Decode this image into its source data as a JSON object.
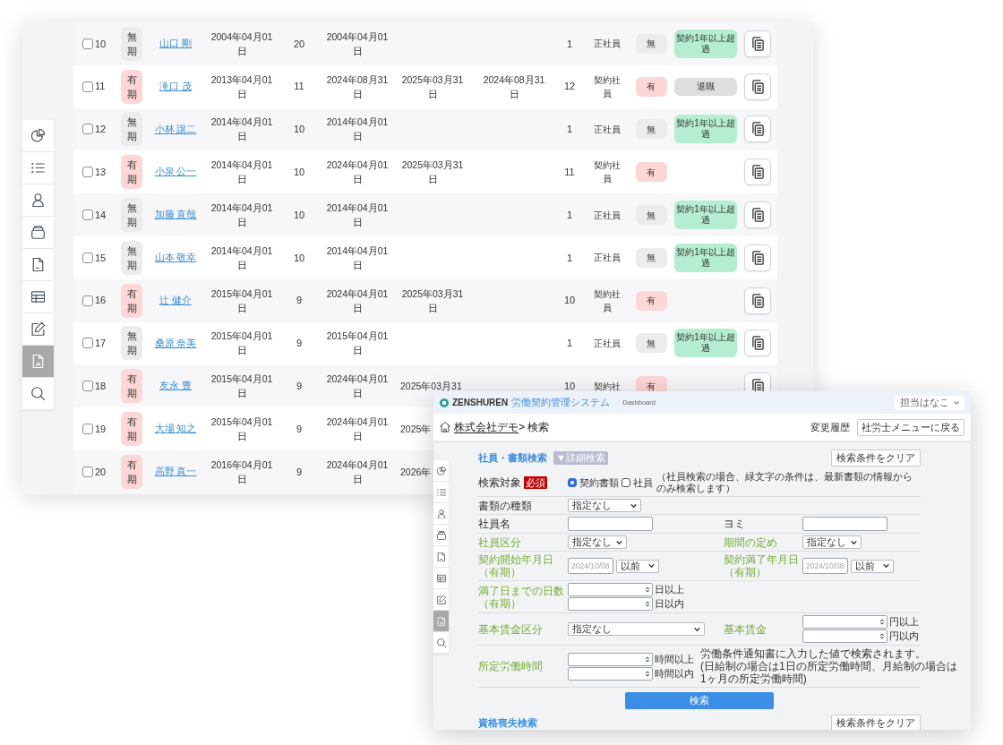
{
  "table_window": {
    "sidebar": [
      {
        "selected": false
      },
      {
        "selected": false
      },
      {
        "selected": false
      },
      {
        "selected": false
      },
      {
        "selected": false
      },
      {
        "selected": false
      },
      {
        "selected": false
      },
      {
        "selected": true
      },
      {
        "selected": false
      }
    ],
    "rows": [
      {
        "checked": false,
        "number": "10",
        "term": {
          "text": "無期",
          "color": "#ececec"
        },
        "name": "山口 剛",
        "date_1": "2004年04月01日",
        "count_1": "20",
        "date_2": "2004年04月01日",
        "count_2": "1",
        "type": "正社員",
        "flag": {
          "text": "無",
          "color": "#ececec"
        },
        "status": {
          "text": "契約1年以上超過",
          "color": "#b4edd1"
        },
        "copy_button": true
      },
      {
        "checked": false,
        "number": "11",
        "term": {
          "text": "有期",
          "color": "#fdd6d6"
        },
        "name": "滝口 茂",
        "date_1": "2013年04月01日",
        "count_1": "11",
        "date_2": "2024年08月31日",
        "date_3": "2025年03月31日",
        "date_4": "2024年08月31日",
        "count_2": "12",
        "type": "契約社員",
        "flag": {
          "text": "有",
          "color": "#fdd6d6"
        },
        "status": {
          "text": "退職",
          "color": "#dedede"
        },
        "copy_button": true
      },
      {
        "checked": false,
        "number": "12",
        "term": {
          "text": "無期",
          "color": "#ececec"
        },
        "name": "小林 譲二",
        "date_1": "2014年04月01日",
        "count_1": "10",
        "date_2": "2014年04月01日",
        "count_2": "1",
        "type": "正社員",
        "flag": {
          "text": "無",
          "color": "#ececec"
        },
        "status": {
          "text": "契約1年以上超過",
          "color": "#b4edd1"
        },
        "copy_button": true
      },
      {
        "checked": false,
        "number": "13",
        "term": {
          "text": "有期",
          "color": "#fdd6d6"
        },
        "name": "小泉 公一",
        "date_1": "2014年04月01日",
        "count_1": "10",
        "date_2": "2024年04月01日",
        "date_3": "2025年03月31日",
        "count_2": "11",
        "type": "契約社員",
        "flag": {
          "text": "有",
          "color": "#fdd6d6"
        },
        "copy_button": true
      },
      {
        "checked": false,
        "number": "14",
        "term": {
          "text": "無期",
          "color": "#ececec"
        },
        "name": "加藤 直哉",
        "date_1": "2014年04月01日",
        "count_1": "10",
        "date_2": "2014年04月01日",
        "count_2": "1",
        "type": "正社員",
        "flag": {
          "text": "無",
          "color": "#ececec"
        },
        "status": {
          "text": "契約1年以上超過",
          "color": "#b4edd1"
        },
        "copy_button": true
      },
      {
        "checked": false,
        "number": "15",
        "term": {
          "text": "無期",
          "color": "#ececec"
        },
        "name": "山本 敬幸",
        "date_1": "2014年04月01日",
        "count_1": "10",
        "date_2": "2014年04月01日",
        "count_2": "1",
        "type": "正社員",
        "flag": {
          "text": "無",
          "color": "#ececec"
        },
        "status": {
          "text": "契約1年以上超過",
          "color": "#b4edd1"
        },
        "copy_button": true
      },
      {
        "checked": false,
        "number": "16",
        "term": {
          "text": "有期",
          "color": "#fdd6d6"
        },
        "name": "辻 健介",
        "date_1": "2015年04月01日",
        "count_1": "9",
        "date_2": "2024年04月01日",
        "date_3": "2025年03月31日",
        "count_2": "10",
        "type": "契約社員",
        "flag": {
          "text": "有",
          "color": "#fdd6d6"
        },
        "copy_button": true
      },
      {
        "checked": false,
        "number": "17",
        "term": {
          "text": "無期",
          "color": "#ececec"
        },
        "name": "桑原 奈美",
        "date_1": "2015年04月01日",
        "count_1": "9",
        "date_2": "2015年04月01日",
        "count_2": "1",
        "type": "正社員",
        "flag": {
          "text": "無",
          "color": "#ececec"
        },
        "status": {
          "text": "契約1年以上超過",
          "color": "#b4edd1"
        },
        "copy_button": true
      },
      {
        "checked": false,
        "number": "18",
        "term": {
          "text": "有期",
          "color": "#fdd6d6"
        },
        "name": "友永 豊",
        "date_1": "2015年04月01日",
        "count_1": "9",
        "date_2": "2024年04月01日",
        "date_3": "2025年03月31",
        "count_2": "10",
        "type": "契約社",
        "flag": {
          "text": "有",
          "color": "#fdd6d6"
        },
        "copy_button": true
      },
      {
        "checked": false,
        "number": "19",
        "term": {
          "text": "有期",
          "color": "#fdd6d6"
        },
        "name": "大場 知之",
        "date_1": "2015年04月01日",
        "count_1": "9",
        "date_2": "2024年04月01日",
        "date_3": "2025年"
      },
      {
        "checked": false,
        "number": "20",
        "term": {
          "text": "有期",
          "color": "#fdd6d6"
        },
        "name": "高野 真一",
        "date_1": "2016年04月01日",
        "count_1": "9",
        "date_2": "2024年04月01日",
        "date_3": "2026年"
      }
    ]
  },
  "search_window": {
    "header": {
      "brand": "ZENSHUREN",
      "system_name": "労働契約管理システム",
      "nav_link": "Dashboard",
      "user_menu": "担当はなこ"
    },
    "breadcrumb": {
      "company_link": "株式会社デモ",
      "current": "> 検索",
      "history_link": "変更履歴",
      "back_button": "社労士メニューに戻る"
    },
    "sidebar": [
      {
        "selected": false
      },
      {
        "selected": false
      },
      {
        "selected": false
      },
      {
        "selected": false
      },
      {
        "selected": false
      },
      {
        "selected": false
      },
      {
        "selected": false
      },
      {
        "selected": true
      },
      {
        "selected": false
      }
    ],
    "search_form": {
      "title": "社員・書類検索",
      "detail_toggle": "▼詳細検索",
      "clear_button": "検索条件をクリア",
      "target": {
        "label": "検索対象",
        "required": "必須",
        "options": [
          {
            "label": "契約書類",
            "selected": true
          },
          {
            "label": "社員",
            "selected": false
          }
        ],
        "note": "（社員検索の場合、緑文字の条件は、最新書類の情報からのみ検索します）"
      },
      "rows": [
        {
          "fields": [
            {
              "label": "書類の種類",
              "latest_document_only": false,
              "controls": [
                {
                  "kind": "select",
                  "value": "指定なし"
                }
              ]
            }
          ]
        },
        {
          "fields": [
            {
              "label": "社員名",
              "latest_document_only": false,
              "controls": [
                {
                  "kind": "text"
                }
              ]
            },
            {
              "label": "ヨミ",
              "latest_document_only": false,
              "controls": [
                {
                  "kind": "text"
                }
              ]
            }
          ]
        },
        {
          "fields": [
            {
              "label": "社員区分",
              "latest_document_only": true,
              "controls": [
                {
                  "kind": "select",
                  "value": "指定なし"
                }
              ]
            },
            {
              "label": "期間の定め",
              "latest_document_only": true,
              "controls": [
                {
                  "kind": "select",
                  "value": "指定なし"
                }
              ]
            }
          ]
        },
        {
          "fields": [
            {
              "label": "契約開始年月日（有期）",
              "latest_document_only": true,
              "controls": [
                {
                  "kind": "date",
                  "placeholder": "2024/10/08"
                },
                {
                  "kind": "select",
                  "value": "以前"
                }
              ]
            },
            {
              "label": "契約満了年月日（有期）",
              "latest_document_only": true,
              "controls": [
                {
                  "kind": "date",
                  "placeholder": "2024/10/08"
                },
                {
                  "kind": "select",
                  "value": "以前"
                }
              ]
            }
          ]
        },
        {
          "fields": [
            {
              "label": "満了日までの日数（有期）",
              "latest_document_only": true,
              "controls": [
                {
                  "kind": "number",
                  "suffix": "日以上"
                },
                {
                  "kind": "number",
                  "suffix": "日以内"
                }
              ]
            }
          ]
        },
        {
          "fields": [
            {
              "label": "基本賃金区分",
              "latest_document_only": true,
              "controls": [
                {
                  "kind": "select",
                  "value": "指定なし"
                }
              ]
            },
            {
              "label": "基本賃金",
              "latest_document_only": true,
              "controls": [
                {
                  "kind": "number",
                  "suffix": "円以上"
                },
                {
                  "kind": "number",
                  "suffix": "円以内"
                }
              ]
            }
          ]
        },
        {
          "fields": [
            {
              "label": "所定労働時間",
              "latest_document_only": true,
              "controls": [
                {
                  "kind": "number",
                  "suffix": "時間以上"
                },
                {
                  "kind": "number",
                  "suffix": "時間以内"
                }
              ]
            }
          ],
          "notes": [
            "労働条件通知書に入力した値で検索されます。",
            "(日給制の場合は1日の所定労働時間、月給制の場合は1ヶ月の所定労働時間)"
          ]
        }
      ],
      "submit_button": "検索"
    },
    "next_section": {
      "title": "資格喪失検索",
      "clear_button": "検索条件をクリア"
    }
  }
}
